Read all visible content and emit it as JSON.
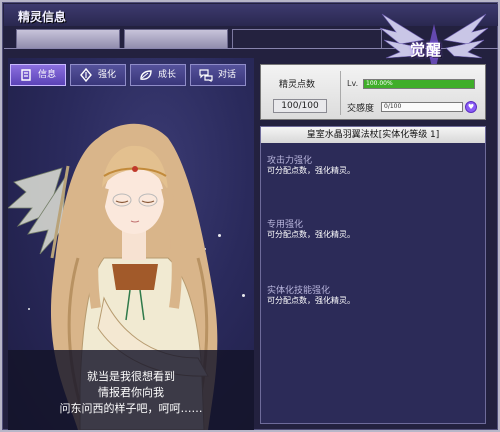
{
  "window": {
    "title": "精灵信息"
  },
  "logo": {
    "text": "觉醒"
  },
  "nav": [
    {
      "label": "信息",
      "icon": "info-icon",
      "active": true
    },
    {
      "label": "强化",
      "icon": "enhance-icon",
      "active": false
    },
    {
      "label": "成长",
      "icon": "growth-icon",
      "active": false
    },
    {
      "label": "对话",
      "icon": "chat-icon",
      "active": false
    }
  ],
  "dialogue": {
    "lines": [
      "就当是我很想看到",
      "情报君你向我",
      "问东问西的样子吧，呵呵……"
    ]
  },
  "stats": {
    "points_label": "精灵点数",
    "points_value": "100/100",
    "lv_label": "Lv.",
    "lv_value": "100.00%",
    "lv_progress": 1.0,
    "affinity_label": "交感度",
    "affinity_value": "0/100",
    "affinity_progress": 0.0
  },
  "panel": {
    "header": "皇室水晶羽翼法杖[实体化等级 1]",
    "sections": [
      {
        "title": "攻击力强化",
        "desc": "可分配点数，强化精灵。"
      },
      {
        "title": "专用强化",
        "desc": "可分配点数，强化精灵。"
      },
      {
        "title": "实体化技能强化",
        "desc": "可分配点数，强化精灵。"
      }
    ]
  },
  "colors": {
    "accent": "#8b6fe0",
    "lv_bar": "#3fae29",
    "affinity_bar": "#8b5cf6",
    "background": "#23213f"
  }
}
